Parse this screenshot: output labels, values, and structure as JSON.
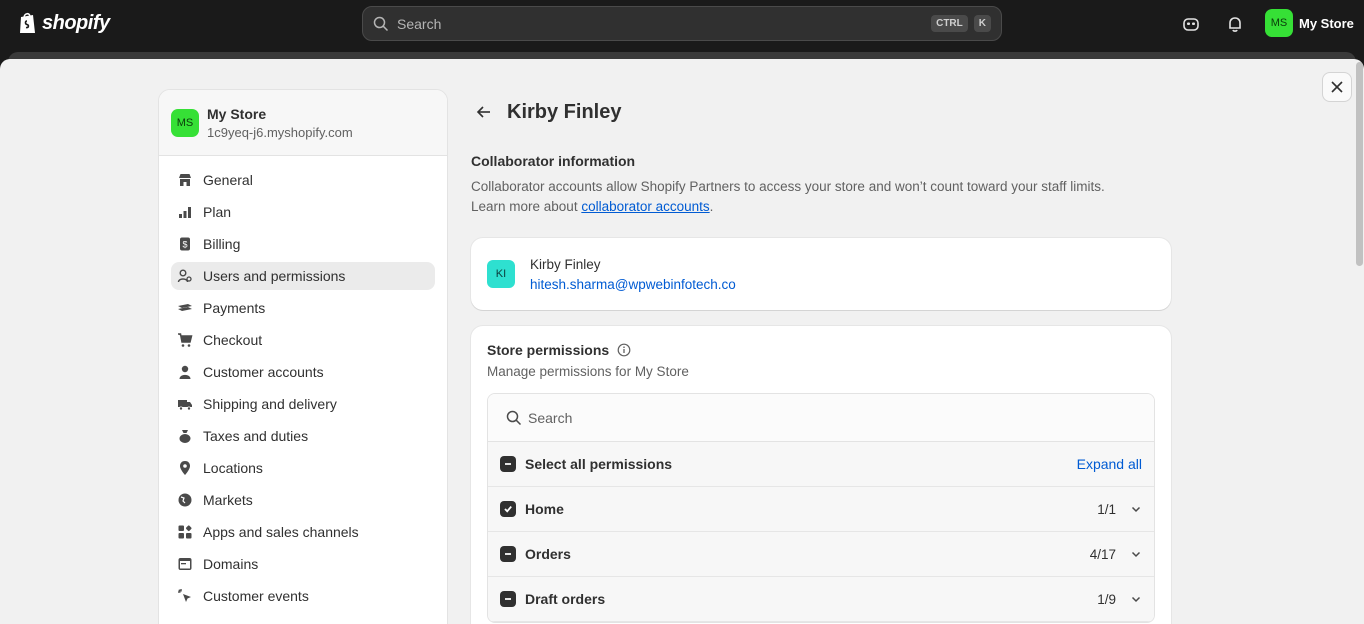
{
  "topbar": {
    "brand": "shopify",
    "search_placeholder": "Search",
    "shortcut_ctrl": "CTRL",
    "shortcut_k": "K",
    "store_initials": "MS",
    "store_name": "My Store"
  },
  "sidebar": {
    "store_initials": "MS",
    "store_name": "My Store",
    "store_domain": "1c9yeq-j6.myshopify.com",
    "items": [
      {
        "label": "General",
        "icon": "store-icon"
      },
      {
        "label": "Plan",
        "icon": "plan-icon"
      },
      {
        "label": "Billing",
        "icon": "billing-icon"
      },
      {
        "label": "Users and permissions",
        "icon": "users-icon",
        "active": true
      },
      {
        "label": "Payments",
        "icon": "payments-icon"
      },
      {
        "label": "Checkout",
        "icon": "cart-icon"
      },
      {
        "label": "Customer accounts",
        "icon": "person-icon"
      },
      {
        "label": "Shipping and delivery",
        "icon": "truck-icon"
      },
      {
        "label": "Taxes and duties",
        "icon": "tax-icon"
      },
      {
        "label": "Locations",
        "icon": "location-icon"
      },
      {
        "label": "Markets",
        "icon": "globe-icon"
      },
      {
        "label": "Apps and sales channels",
        "icon": "apps-icon"
      },
      {
        "label": "Domains",
        "icon": "domains-icon"
      },
      {
        "label": "Customer events",
        "icon": "cursor-icon"
      }
    ]
  },
  "main": {
    "title": "Kirby Finley",
    "section_title": "Collaborator information",
    "section_desc_1": "Collaborator accounts allow Shopify Partners to access your store and won’t count toward your staff limits.",
    "section_desc_2": "Learn more about ",
    "section_link": "collaborator accounts",
    "section_desc_3": ".",
    "collaborator": {
      "initials": "KI",
      "name": "Kirby Finley",
      "email": "hitesh.sharma@wpwebinfotech.co"
    },
    "permissions": {
      "title": "Store permissions",
      "subtitle": "Manage permissions for My Store",
      "search_placeholder": "Search",
      "select_all": "Select all permissions",
      "expand_all": "Expand all",
      "rows": [
        {
          "label": "Home",
          "count": "1/1",
          "state": "checked"
        },
        {
          "label": "Orders",
          "count": "4/17",
          "state": "partial"
        },
        {
          "label": "Draft orders",
          "count": "1/9",
          "state": "partial"
        }
      ]
    }
  },
  "colors": {
    "link": "#005bd3",
    "avatar_green": "#36e036",
    "avatar_teal": "#2ee0d0",
    "topbar": "#1a1a1a"
  }
}
